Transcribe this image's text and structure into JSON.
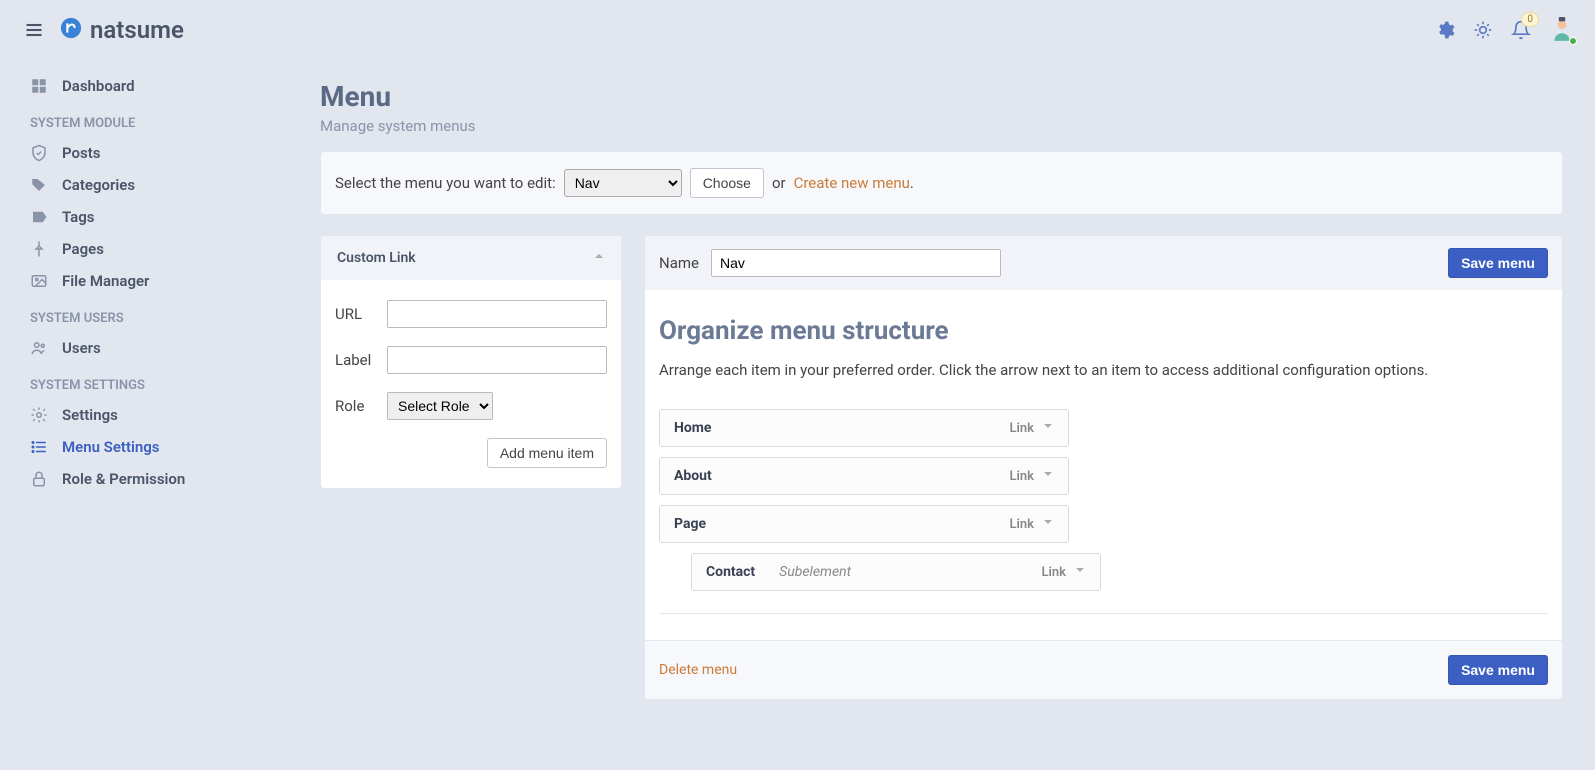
{
  "header": {
    "app_title": "natsume",
    "notif_count": "0"
  },
  "sidebar": {
    "dashboard": "Dashboard",
    "section_module": "SYSTEM MODULE",
    "posts": "Posts",
    "categories": "Categories",
    "tags": "Tags",
    "pages": "Pages",
    "file_manager": "File Manager",
    "section_users": "SYSTEM USERS",
    "users": "Users",
    "section_settings": "SYSTEM SETTINGS",
    "settings": "Settings",
    "menu_settings": "Menu Settings",
    "role_permission": "Role & Permission"
  },
  "page": {
    "title": "Menu",
    "subtitle": "Manage system menus"
  },
  "select_bar": {
    "label": "Select the menu you want to edit:",
    "selected": "Nav",
    "choose": "Choose",
    "or": "or",
    "create": "Create new menu",
    "dot": "."
  },
  "custom_link": {
    "title": "Custom Link",
    "url_label": "URL",
    "url_value": "",
    "label_label": "Label",
    "label_value": "",
    "role_label": "Role",
    "role_selected": "Select Role",
    "add_btn": "Add menu item"
  },
  "menu_editor": {
    "name_label": "Name",
    "name_value": "Nav",
    "save_btn": "Save menu",
    "org_title": "Organize menu structure",
    "org_desc": "Arrange each item in your preferred order. Click the arrow next to an item to access additional configuration options.",
    "items": [
      {
        "label": "Home",
        "type": "Link",
        "note": "",
        "sub": false
      },
      {
        "label": "About",
        "type": "Link",
        "note": "",
        "sub": false
      },
      {
        "label": "Page",
        "type": "Link",
        "note": "",
        "sub": false
      },
      {
        "label": "Contact",
        "type": "Link",
        "note": "Subelement",
        "sub": true
      }
    ],
    "delete": "Delete menu",
    "save_btn2": "Save menu"
  }
}
